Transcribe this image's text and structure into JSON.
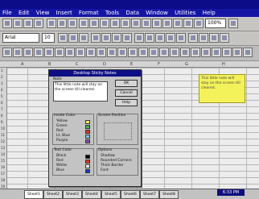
{
  "menubar": {
    "items": [
      "File",
      "Edit",
      "View",
      "Insert",
      "Format",
      "Tools",
      "Data",
      "Window",
      "Utilities",
      "Help"
    ]
  },
  "toolbar": {
    "zoom": "100%",
    "font": "Arial",
    "size": "10"
  },
  "sheet": {
    "columns": [
      "A",
      "B",
      "C",
      "D",
      "E",
      "F",
      "G",
      "H"
    ],
    "rows": [
      "1",
      "2",
      "3",
      "4",
      "5",
      "6",
      "7",
      "8",
      "9",
      "10",
      "11",
      "12",
      "13",
      "14",
      "15",
      "16",
      "17",
      "18",
      "19"
    ]
  },
  "dialog": {
    "title": "Desktop Sticky Notes",
    "note_label": "Note",
    "note_text": "This little note will stay on the screen till cleared.",
    "ok": "OK",
    "cancel": "Cancel",
    "help": "Help",
    "inside_color_label": "Inside Color",
    "inside_colors": [
      "Yellow",
      "Green",
      "Red",
      "Lt. Blue",
      "Purple"
    ],
    "screen_position_label": "Screen Position",
    "text_color_label": "Text Color",
    "text_colors": [
      "Black",
      "Red",
      "White",
      "Blue"
    ],
    "options_label": "Options",
    "options": [
      "Shadow",
      "Rounded Corners",
      "Thick Border",
      "Font"
    ]
  },
  "sticky": {
    "text": "This little note will stay on the screen till cleared."
  },
  "tabs": {
    "items": [
      "Sheet1",
      "Sheet2",
      "Sheet3",
      "Sheet4",
      "Sheet5",
      "Sheet6",
      "Sheet7",
      "Sheet8"
    ]
  },
  "status": {
    "time": "6:33 PM"
  },
  "colors": {
    "inside": [
      "#f5f16b",
      "#49b34f",
      "#d83b2b",
      "#7ec6e6",
      "#8a4fa9"
    ],
    "text": [
      "#000000",
      "#d83b2b",
      "#ffffff",
      "#1e37c3"
    ]
  }
}
